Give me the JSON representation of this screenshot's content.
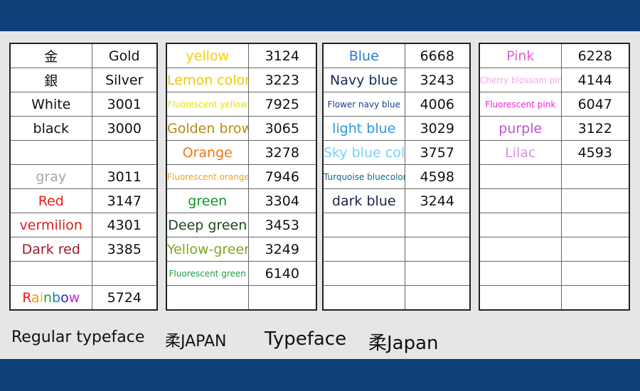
{
  "colors": {
    "band": "#0f3f78",
    "background": "#e6e6e6"
  },
  "tables": [
    {
      "rows": [
        {
          "name": "金",
          "code": "Gold",
          "color": "#111111"
        },
        {
          "name": "銀",
          "code": "Silver",
          "color": "#111111"
        },
        {
          "name": "White",
          "code": "3001",
          "color": "#111111"
        },
        {
          "name": "black",
          "code": "3000",
          "color": "#111111"
        },
        {
          "name": "",
          "code": "",
          "color": "#111111"
        },
        {
          "name": "gray",
          "code": "3011",
          "color": "#a8a8a8"
        },
        {
          "name": "Red",
          "code": "3147",
          "color": "#e8201a"
        },
        {
          "name": "vermilion",
          "code": "4301",
          "color": "#d2201e"
        },
        {
          "name": "Dark red",
          "code": "3385",
          "color": "#a01a28"
        },
        {
          "name": "",
          "code": "",
          "color": "#111111"
        },
        {
          "name": "Rainbow",
          "code": "5724",
          "color": "#111111",
          "rainbow": [
            "#e8201a",
            "#ff9000",
            "#e6c800",
            "#19a832",
            "#1a6fd6",
            "#1a2aa8",
            "#c02ad8"
          ]
        }
      ]
    },
    {
      "rows": [
        {
          "name": "yellow",
          "code": "3124",
          "color": "#f2d400"
        },
        {
          "name": "Lemon color",
          "code": "3223",
          "color": "#f0c800"
        },
        {
          "name": "Fluorescent yellow",
          "code": "7925",
          "color": "#e8e000",
          "small": true
        },
        {
          "name": "Golden brown",
          "code": "3065",
          "color": "#b88a10"
        },
        {
          "name": "Orange",
          "code": "3278",
          "color": "#f07810"
        },
        {
          "name": "Fluorescent orange",
          "code": "7946",
          "color": "#f0a020",
          "small": true
        },
        {
          "name": "green",
          "code": "3304",
          "color": "#12962a"
        },
        {
          "name": "Deep green",
          "code": "3453",
          "color": "#1a4a1a"
        },
        {
          "name": "Yellow-green",
          "code": "3249",
          "color": "#7aa820"
        },
        {
          "name": "Fluorescent green",
          "code": "6140",
          "color": "#18a040",
          "small": true
        },
        {
          "name": "",
          "code": "",
          "color": "#111111"
        }
      ]
    },
    {
      "rows": [
        {
          "name": "Blue",
          "code": "6668",
          "color": "#2a7ad0"
        },
        {
          "name": "Navy blue",
          "code": "3243",
          "color": "#152a5a"
        },
        {
          "name": "Flower navy blue",
          "code": "4006",
          "color": "#1a3c88",
          "small": true
        },
        {
          "name": "light blue",
          "code": "3029",
          "color": "#2a9ae0"
        },
        {
          "name": "Sky blue color",
          "code": "3757",
          "color": "#7ad0f8"
        },
        {
          "name": "Turquoise bluecolor",
          "code": "4598",
          "color": "#106a8a",
          "small": true
        },
        {
          "name": "dark blue",
          "code": "3244",
          "color": "#142448"
        },
        {
          "name": "",
          "code": "",
          "color": "#111111"
        },
        {
          "name": "",
          "code": "",
          "color": "#111111"
        },
        {
          "name": "",
          "code": "",
          "color": "#111111"
        },
        {
          "name": "",
          "code": "",
          "color": "#111111"
        }
      ]
    },
    {
      "rows": [
        {
          "name": "Pink",
          "code": "6228",
          "color": "#e060d0"
        },
        {
          "name": "Cherry blossom pink",
          "code": "4144",
          "color": "#f0a8e8",
          "small": true
        },
        {
          "name": "Fluorescent pink",
          "code": "6047",
          "color": "#f020d0",
          "small": true
        },
        {
          "name": "purple",
          "code": "3122",
          "color": "#c050d8"
        },
        {
          "name": "Lilac",
          "code": "4593",
          "color": "#d890e8"
        },
        {
          "name": "",
          "code": "",
          "color": "#111111"
        },
        {
          "name": "",
          "code": "",
          "color": "#111111"
        },
        {
          "name": "",
          "code": "",
          "color": "#111111"
        },
        {
          "name": "",
          "code": "",
          "color": "#111111"
        },
        {
          "name": "",
          "code": "",
          "color": "#111111"
        },
        {
          "name": "",
          "code": "",
          "color": "#111111"
        }
      ]
    }
  ],
  "footer": {
    "label1": "Regular typeface",
    "label2": "柔JAPAN",
    "label3": "Typeface",
    "label4": "柔Japan"
  }
}
